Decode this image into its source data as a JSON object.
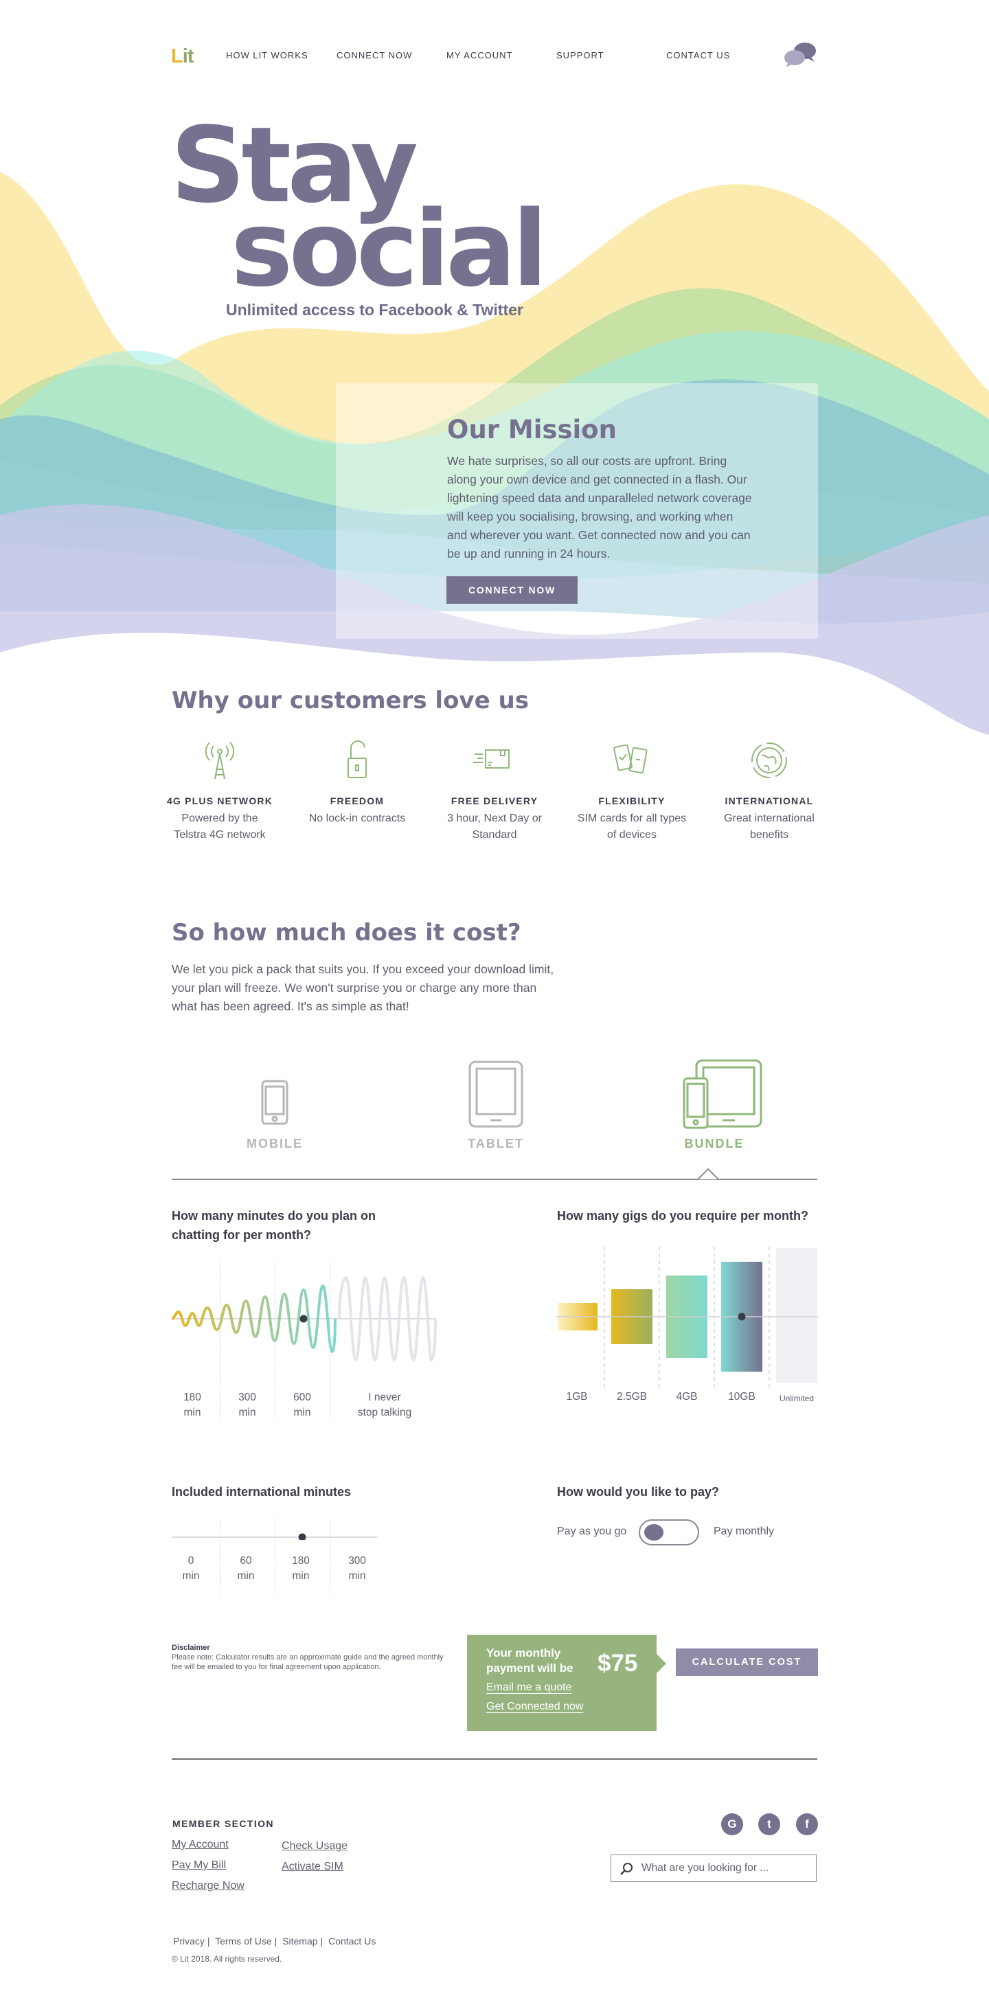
{
  "brand": {
    "logo_text_l": "L",
    "logo_text_rest": "it"
  },
  "nav": [
    {
      "label": "HOW LIT WORKS"
    },
    {
      "label": "CONNECT NOW"
    },
    {
      "label": "MY ACCOUNT"
    },
    {
      "label": "SUPPORT"
    },
    {
      "label": "CONTACT US"
    }
  ],
  "hero": {
    "title_line1": "Stay",
    "title_line2": "social",
    "subtitle": "Unlimited access to Facebook & Twitter"
  },
  "mission": {
    "title": "Our Mission",
    "body": "We hate surprises, so all our costs are upfront. Bring along your own device and get connected in a flash. Our lightening speed data and unparalleled network coverage will keep you socialising, browsing, and working when and wherever you want. Get connected now and you can be up and running in 24 hours.",
    "button": "CONNECT NOW"
  },
  "love": {
    "title": "Why our customers love us",
    "features": [
      {
        "icon": "cell-tower-icon",
        "title": "4G PLUS NETWORK",
        "desc": "Powered by the Telstra 4G network"
      },
      {
        "icon": "unlocked-padlock-icon",
        "title": "FREEDOM",
        "desc": "No lock-in contracts"
      },
      {
        "icon": "delivery-box-icon",
        "title": "FREE DELIVERY",
        "desc": "3 hour, Next Day or Standard"
      },
      {
        "icon": "devices-icon",
        "title": "FLEXIBILITY",
        "desc": "SIM cards for all types of devices"
      },
      {
        "icon": "globe-icon",
        "title": "INTERNATIONAL",
        "desc": "Great international benefits"
      }
    ]
  },
  "cost": {
    "title": "So how much does it cost?",
    "body": "We let you pick a pack that suits you. If you exceed your download limit, your plan will freeze. We won't surprise you or charge any more than what has been agreed. It's as simple as that!"
  },
  "devices": [
    {
      "icon": "mobile-icon",
      "label": "MOBILE",
      "active": false
    },
    {
      "icon": "tablet-icon",
      "label": "TABLET",
      "active": false
    },
    {
      "icon": "bundle-icon",
      "label": "BUNDLE",
      "active": true
    }
  ],
  "minutes": {
    "question": "How many minutes do you plan on chatting for per month?",
    "options": [
      {
        "line1": "180",
        "line2": "min"
      },
      {
        "line1": "300",
        "line2": "min"
      },
      {
        "line1": "600",
        "line2": "min"
      },
      {
        "line1": "I never",
        "line2": "stop talking"
      }
    ],
    "selected_index": 2
  },
  "gigs": {
    "question": "How many gigs do you require per month?",
    "options": [
      "1GB",
      "2.5GB",
      "4GB",
      "10GB",
      "Unlimited"
    ],
    "selected_index": 3
  },
  "international": {
    "question": "Included international minutes",
    "options": [
      {
        "line1": "0",
        "line2": "min"
      },
      {
        "line1": "60",
        "line2": "min"
      },
      {
        "line1": "180",
        "line2": "min"
      },
      {
        "line1": "300",
        "line2": "min"
      }
    ],
    "selected_index": 2
  },
  "payment": {
    "question": "How would you like to pay?",
    "left_label": "Pay as you go",
    "right_label": "Pay monthly",
    "selected": "Pay as you go"
  },
  "disclaimer": {
    "title": "Disclaimer",
    "body": "Please note: Calculator results are an approximate guide and the agreed monthly fee will be emailed to you for final agreement upon application."
  },
  "result": {
    "label": "Your monthly payment will be",
    "amount": "$75",
    "email_link": "Email me a quote",
    "connect_link": "Get Connected now",
    "calc_button": "CALCULATE COST"
  },
  "footer": {
    "member_title": "MEMBER SECTION",
    "links_col1": [
      "My Account",
      "Pay My Bill",
      "Recharge Now"
    ],
    "links_col2": [
      "Check Usage",
      "Activate SIM"
    ],
    "social": [
      {
        "icon": "google-icon",
        "glyph": "G"
      },
      {
        "icon": "twitter-icon",
        "glyph": "t"
      },
      {
        "icon": "facebook-icon",
        "glyph": "f"
      }
    ],
    "search_placeholder": "What are you looking for ...",
    "legal": [
      "Privacy",
      "Terms of Use",
      "Sitemap",
      "Contact Us"
    ],
    "copyright": "© Lit 2018. All rights reserved."
  },
  "colors": {
    "primary": "#75718f",
    "green": "#97b47f",
    "yellow": "#e6b830",
    "teal": "#7fd8cf"
  }
}
